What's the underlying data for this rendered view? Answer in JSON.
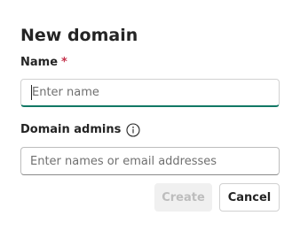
{
  "dialog": {
    "title": "New domain",
    "name_field": {
      "label": "Name",
      "required_marker": "*",
      "placeholder": "Enter name",
      "value": ""
    },
    "admins_field": {
      "label": "Domain admins",
      "info_icon": "info-icon",
      "placeholder": "Enter names or email addresses",
      "value": ""
    },
    "buttons": {
      "create_label": "Create",
      "create_disabled": true,
      "cancel_label": "Cancel"
    },
    "colors": {
      "focus_underline": "#117865",
      "required": "#c4314b",
      "disabled_text": "#bdbdbd",
      "disabled_bg": "#f0f0f0"
    }
  }
}
